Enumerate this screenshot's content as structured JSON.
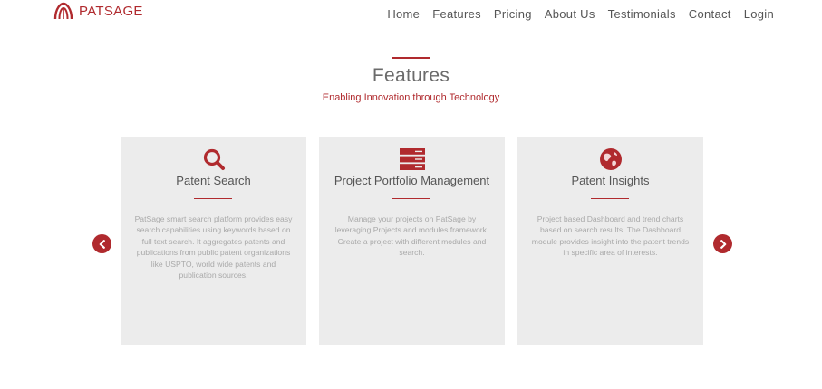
{
  "header": {
    "logo_text": "PATSAGE",
    "nav": [
      {
        "label": "Home"
      },
      {
        "label": "Features"
      },
      {
        "label": "Pricing"
      },
      {
        "label": "About Us"
      },
      {
        "label": "Testimonials"
      },
      {
        "label": "Contact"
      },
      {
        "label": "Login"
      }
    ]
  },
  "section": {
    "title": "Features",
    "subtitle": "Enabling Innovation through Technology"
  },
  "cards": [
    {
      "icon": "search-icon",
      "title": "Patent Search",
      "text": "PatSage smart search platform provides easy search capabilities using keywords based on full text search. It aggregates patents and publications from public patent organizations like USPTO, world wide patents and publication sources."
    },
    {
      "icon": "server-icon",
      "title": "Project Portfolio Management",
      "text": "Manage your projects on PatSage by leveraging Projects and modules framework. Create a project with different modules and search."
    },
    {
      "icon": "globe-icon",
      "title": "Patent Insights",
      "text": "Project based Dashboard and trend charts based on search results. The Dashboard module provides insight into the patent trends in specific area of interests."
    }
  ],
  "colors": {
    "accent": "#b02a2e",
    "card_bg": "#ececec",
    "body_text": "#a9a9a9"
  }
}
